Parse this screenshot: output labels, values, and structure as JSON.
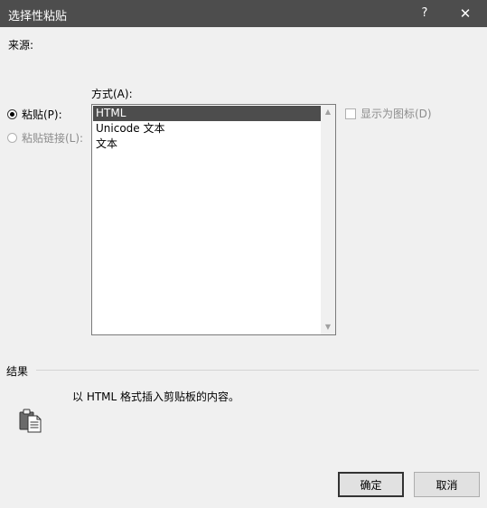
{
  "window": {
    "title": "选择性粘贴",
    "help": "?",
    "close": "✕"
  },
  "source": {
    "label": "来源:"
  },
  "options": {
    "paste_label": "粘贴(P):",
    "paste_link_label": "粘贴链接(L):"
  },
  "mode": {
    "label": "方式(A):",
    "items": [
      "HTML",
      "Unicode 文本",
      "文本"
    ],
    "selected": "HTML"
  },
  "display_as_icon": {
    "label": "显示为图标(D)"
  },
  "result": {
    "label": "结果",
    "text": "以 HTML 格式插入剪贴板的内容。"
  },
  "buttons": {
    "ok": "确定",
    "cancel": "取消"
  },
  "icons": {
    "result_icon": "clipboard-icon",
    "scroll_up": "chevron-up-icon",
    "scroll_down": "chevron-down-icon"
  },
  "colors": {
    "titlebar": "#4d4d4d",
    "selection": "#4d4d4d",
    "background": "#f0f0f0"
  }
}
